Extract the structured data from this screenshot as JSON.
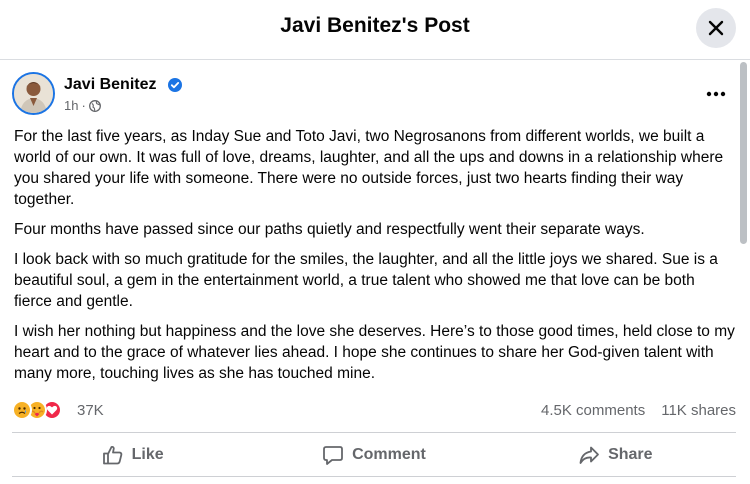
{
  "header": {
    "title": "Javi Benitez's Post",
    "close_icon": "close-icon"
  },
  "post": {
    "author": "Javi Benitez",
    "verified": true,
    "time": "1h",
    "separator": "·",
    "privacy_icon": "globe-icon",
    "more_icon": "more-horizontal-icon",
    "paragraphs": [
      "For the last five years, as Inday Sue and Toto Javi, two Negrosanons from different worlds, we built a world of our own. It was full of love, dreams, laughter, and all the ups and downs in a relationship where you shared your life with someone. There were no outside forces, just two hearts finding their way together.",
      "Four months have passed since our paths quietly and respectfully went their separate ways.",
      "I look back with so much gratitude for the smiles, the laughter, and all the little joys we shared. Sue is a beautiful soul, a gem in the entertainment world, a true talent who showed me that love can be both fierce and gentle.",
      "I wish her nothing but happiness and the love she deserves. Here’s to those good times, held close to my heart and to the grace of whatever lies ahead. I hope she continues to share her God-given talent with many more, touching lives as she has touched mine."
    ]
  },
  "stats": {
    "reactions": [
      "sad-reaction-icon",
      "care-reaction-icon",
      "love-reaction-icon"
    ],
    "reaction_count": "37K",
    "comments": "4.5K comments",
    "shares": "11K shares"
  },
  "actions": {
    "like": "Like",
    "comment": "Comment",
    "share": "Share"
  },
  "colors": {
    "verified": "#1b74e4",
    "love": "#f02849",
    "sad": "#f7b125",
    "secondary_text": "#65676b"
  }
}
